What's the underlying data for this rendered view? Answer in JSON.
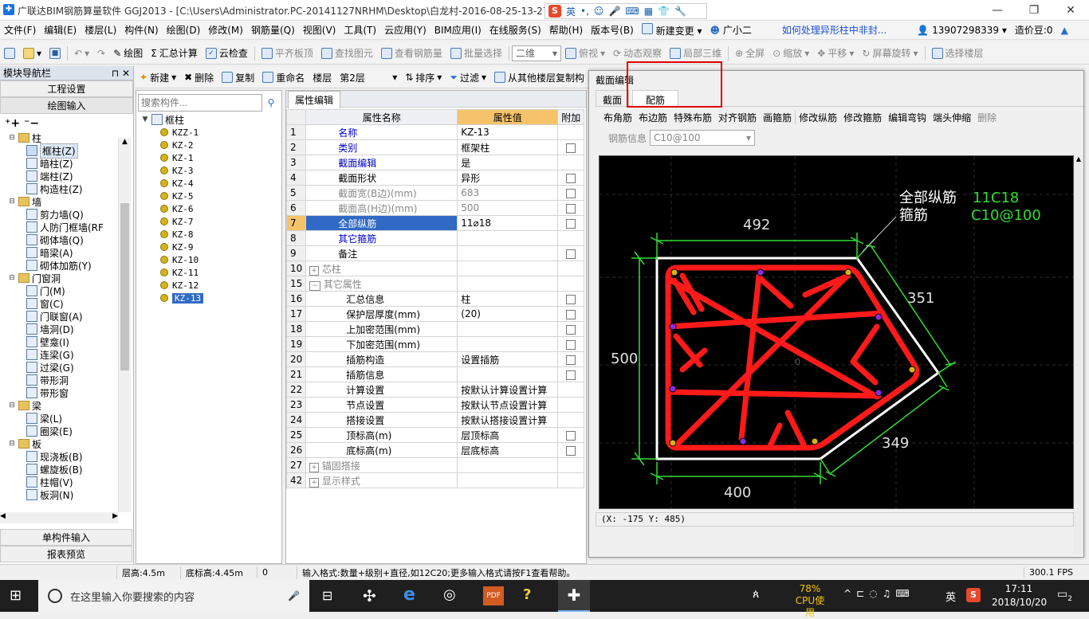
{
  "title_bar": {
    "text": "广联达BIM钢筋算量软件 GGJ2013 - [C:\\Users\\Administrator.PC-20141127NRHM\\Desktop\\白龙村-2016-08-25-13-27",
    "ime": {
      "s_label": "S",
      "lang": "英"
    },
    "buttons": {
      "minimize": "—",
      "restore": "❐",
      "close": "✕"
    }
  },
  "menu": {
    "items": [
      "文件(F)",
      "编辑(E)",
      "楼层(L)",
      "构件(N)",
      "绘图(D)",
      "修改(M)",
      "钢筋量(Q)",
      "视图(V)",
      "工具(T)",
      "云应用(Y)",
      "BIM应用(I)",
      "在线服务(S)",
      "帮助(H)",
      "版本号(B)",
      "新建变更",
      "广小二"
    ],
    "link": "如何处理异形柱中非封...",
    "phone": "13907298339",
    "beans": "造价豆:0"
  },
  "toolbar1": {
    "draw": "绘图",
    "sum": "汇总计算",
    "cloud_check": "云检查",
    "flat_top": "平齐板顶",
    "find": "查找图元",
    "view_rebar": "查看钢筋量",
    "batch_select": "批量选择",
    "view_mode": "二维",
    "top_view": "俯视",
    "dynamic": "动态观察",
    "local3d": "局部三维",
    "full": "全屏",
    "zoom": "缩放",
    "pan": "平移",
    "rotate": "屏幕旋转",
    "select_floor": "选择楼层"
  },
  "toolbar2": {
    "new": "新建",
    "delete": "删除",
    "copy": "复制",
    "rename": "重命名",
    "floor_label": "楼层",
    "floor_value": "第2层",
    "sort": "排序",
    "filter": "过滤",
    "copy_from": "从其他楼层复制构"
  },
  "nav": {
    "title": "模块导航栏",
    "btn_project": "工程设置",
    "btn_draw": "绘图输入",
    "tree": [
      {
        "level": 0,
        "label": "柱"
      },
      {
        "level": 1,
        "label": "框柱(Z)",
        "selected": true
      },
      {
        "level": 1,
        "label": "暗柱(Z)"
      },
      {
        "level": 1,
        "label": "端柱(Z)"
      },
      {
        "level": 1,
        "label": "构造柱(Z)"
      },
      {
        "level": 0,
        "label": "墙"
      },
      {
        "level": 1,
        "label": "剪力墙(Q)"
      },
      {
        "level": 1,
        "label": "人防门框墙(RF"
      },
      {
        "level": 1,
        "label": "砌体墙(Q)"
      },
      {
        "level": 1,
        "label": "暗梁(A)"
      },
      {
        "level": 1,
        "label": "砌体加筋(Y)"
      },
      {
        "level": 0,
        "label": "门窗洞"
      },
      {
        "level": 1,
        "label": "门(M)"
      },
      {
        "level": 1,
        "label": "窗(C)"
      },
      {
        "level": 1,
        "label": "门联窗(A)"
      },
      {
        "level": 1,
        "label": "墙洞(D)"
      },
      {
        "level": 1,
        "label": "壁龛(I)"
      },
      {
        "level": 1,
        "label": "连梁(G)"
      },
      {
        "level": 1,
        "label": "过梁(G)"
      },
      {
        "level": 1,
        "label": "带形洞"
      },
      {
        "level": 1,
        "label": "带形窗"
      },
      {
        "level": 0,
        "label": "梁"
      },
      {
        "level": 1,
        "label": "梁(L)"
      },
      {
        "level": 1,
        "label": "圈梁(E)"
      },
      {
        "level": 0,
        "label": "板"
      },
      {
        "level": 1,
        "label": "现浇板(B)"
      },
      {
        "level": 1,
        "label": "螺旋板(B)"
      },
      {
        "level": 1,
        "label": "柱帽(V)"
      },
      {
        "level": 1,
        "label": "板洞(N)"
      }
    ],
    "btn_single": "单构件输入",
    "btn_report": "报表预览"
  },
  "components": {
    "search_placeholder": "搜索构件...",
    "root": "框柱",
    "items": [
      "KZZ-1",
      "KZ-2",
      "KZ-1",
      "KZ-3",
      "KZ-4",
      "KZ-5",
      "KZ-6",
      "KZ-7",
      "KZ-8",
      "KZ-9",
      "KZ-10",
      "KZ-11",
      "KZ-12",
      "KZ-13"
    ],
    "selected": "KZ-13"
  },
  "props": {
    "tab": "属性编辑",
    "headers": {
      "name": "属性名称",
      "value": "属性值",
      "extra": "附加"
    },
    "rows": [
      {
        "n": "1",
        "name": "名称",
        "value": "KZ-13",
        "style": "blue",
        "check": false
      },
      {
        "n": "2",
        "name": "类别",
        "value": "框架柱",
        "style": "blue",
        "check": true
      },
      {
        "n": "3",
        "name": "截面编辑",
        "value": "是",
        "style": "blue",
        "check": false
      },
      {
        "n": "4",
        "name": "截面形状",
        "value": "异形",
        "style": "",
        "check": true
      },
      {
        "n": "5",
        "name": "截面宽(B边)(mm)",
        "value": "683",
        "style": "gray",
        "check": true
      },
      {
        "n": "6",
        "name": "截面高(H边)(mm)",
        "value": "500",
        "style": "gray",
        "check": true
      },
      {
        "n": "7",
        "name": "全部纵筋",
        "value": "11⌀18",
        "style": "sel",
        "check": true
      },
      {
        "n": "8",
        "name": "其它箍筋",
        "value": "",
        "style": "blue",
        "check": false
      },
      {
        "n": "9",
        "name": "备注",
        "value": "",
        "style": "",
        "check": true
      },
      {
        "n": "10",
        "name": "芯柱",
        "value": "",
        "style": "grp",
        "check": false
      },
      {
        "n": "15",
        "name": "其它属性",
        "value": "",
        "style": "grpo",
        "check": false
      },
      {
        "n": "16",
        "name": "汇总信息",
        "value": "柱",
        "style": "sub",
        "check": true
      },
      {
        "n": "17",
        "name": "保护层厚度(mm)",
        "value": "(20)",
        "style": "sub",
        "check": true
      },
      {
        "n": "18",
        "name": "上加密范围(mm)",
        "value": "",
        "style": "sub",
        "check": true
      },
      {
        "n": "19",
        "name": "下加密范围(mm)",
        "value": "",
        "style": "sub",
        "check": true
      },
      {
        "n": "20",
        "name": "插筋构造",
        "value": "设置插筋",
        "style": "sub",
        "check": true
      },
      {
        "n": "21",
        "name": "插筋信息",
        "value": "",
        "style": "sub",
        "check": true
      },
      {
        "n": "22",
        "name": "计算设置",
        "value": "按默认计算设置计算",
        "style": "sub",
        "check": false
      },
      {
        "n": "23",
        "name": "节点设置",
        "value": "按默认节点设置计算",
        "style": "sub",
        "check": false
      },
      {
        "n": "24",
        "name": "搭接设置",
        "value": "按默认搭接设置计算",
        "style": "sub",
        "check": false
      },
      {
        "n": "25",
        "name": "顶标高(m)",
        "value": "层顶标高",
        "style": "sub",
        "check": true
      },
      {
        "n": "26",
        "name": "底标高(m)",
        "value": "层底标高",
        "style": "sub",
        "check": true
      },
      {
        "n": "27",
        "name": "锚固搭接",
        "value": "",
        "style": "grp",
        "check": false
      },
      {
        "n": "42",
        "name": "显示样式",
        "value": "",
        "style": "grp",
        "check": false
      }
    ]
  },
  "section": {
    "title": "截面编辑",
    "tabs": [
      "截面",
      "配筋"
    ],
    "active_tab": "配筋",
    "tools": [
      "布角筋",
      "布边筋",
      "特殊布筋",
      "对齐钢筋",
      "画箍筋",
      "修改纵筋",
      "修改箍筋",
      "编辑弯钩",
      "端头伸缩",
      "删除"
    ],
    "rebar_label": "钢筋信息",
    "rebar_value": "C10@100",
    "annot": {
      "l1": "全部纵筋",
      "v1": "11C18",
      "l2": "箍筋",
      "v2": "C10@100"
    },
    "dims": {
      "top": "492",
      "upper_right": "351",
      "left": "500",
      "lower_right": "349",
      "bottom": "400"
    },
    "coord": "(X: -175 Y: 485)",
    "center_mark": "0"
  },
  "status": {
    "floor_h": "层高:4.5m",
    "bottom_h": "底标高:4.45m",
    "zero": "0",
    "hint": "输入格式:数量+级别+直径,如12C20;更多输入格式请按F1查看帮助。",
    "fps": "300.1 FPS"
  },
  "taskbar": {
    "search": "在这里输入你要搜索的内容",
    "cpu_pct": "78%",
    "cpu_label": "CPU使用",
    "lang": "英",
    "time": "17:11",
    "date": "2018/10/20",
    "notif": "2"
  },
  "colors": {
    "rebar": "#ff1a1a",
    "dim": "#33dd33",
    "outline": "#ffffff",
    "select": "#316ac5",
    "header_value": "#f6c26a"
  }
}
